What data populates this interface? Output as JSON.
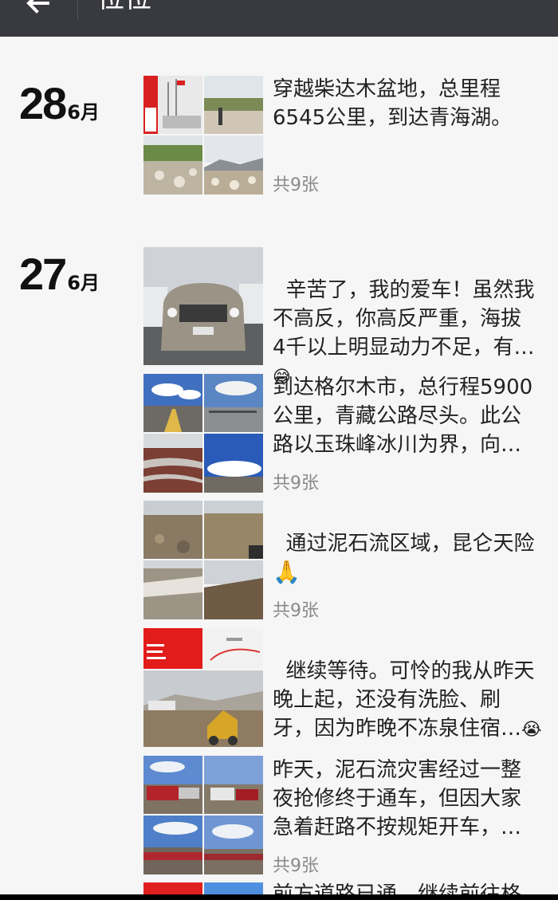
{
  "header": {
    "title": "位位"
  },
  "groups": [
    {
      "day": "28",
      "month": "6月",
      "entries": [
        {
          "text": "穿越柴达木盆地，总里程\n6545公里，到达青海湖。",
          "count": "共9张"
        }
      ]
    },
    {
      "day": "27",
      "month": "6月",
      "entries": [
        {
          "text": "辛苦了，我的爱车！虽然我\n不高反，你高反严重，海拔\n4千以上明显动力不足，有…",
          "emoji": "😅"
        },
        {
          "text": "到达格尔木市，总行程5900\n公里，青藏公路尽头。此公\n路以玉珠峰冰川为界，向…",
          "count": "共9张"
        },
        {
          "text": "通过泥石流区域，昆仑天险",
          "emoji": "🙏",
          "count": "共9张"
        },
        {
          "text": "继续等待。可怜的我从昨天\n晚上起，还没有洗脸、刷\n牙，因为昨晚不冻泉住宿…",
          "emoji": "😭"
        },
        {
          "text": "昨天，泥石流灾害经过一整\n夜抢修终于通车，但因大家\n急着赶路不按规矩开车，…",
          "count": "共9张"
        },
        {
          "text": "前方道路已通，继续前往格…"
        }
      ]
    }
  ],
  "colors": {
    "topbar": "#393a3f",
    "background": "#f6f6f6",
    "count_text": "#8a8a8a"
  }
}
